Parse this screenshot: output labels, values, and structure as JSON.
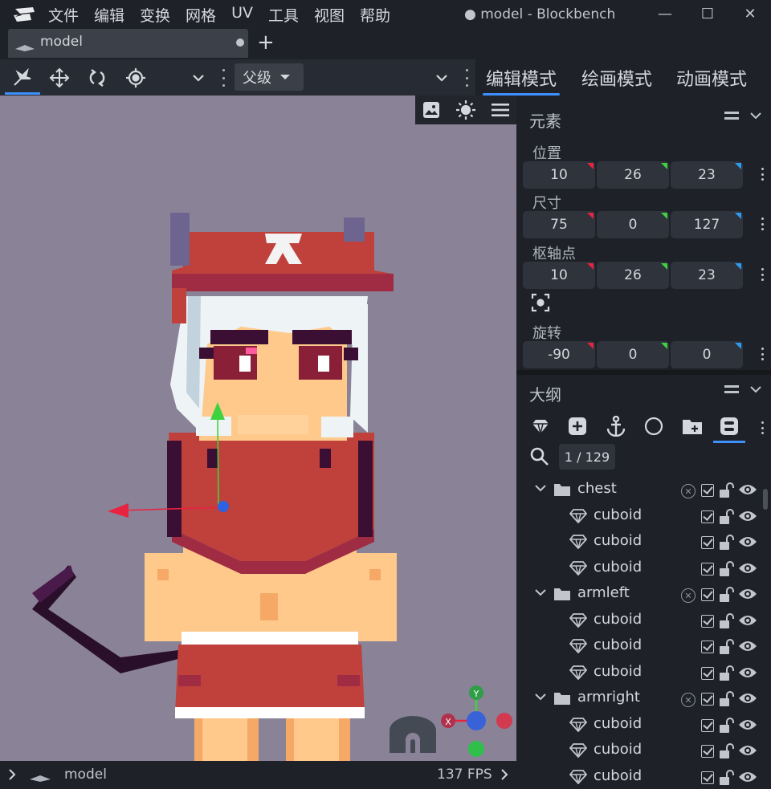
{
  "titlebar": {
    "menu": [
      "文件",
      "编辑",
      "变换",
      "网格",
      "UV",
      "工具",
      "视图",
      "帮助"
    ],
    "window_title": "● model - Blockbench",
    "minimize": "—",
    "maximize": "☐",
    "close": "✕"
  },
  "tabs": [
    {
      "label": "model",
      "unsaved": true
    }
  ],
  "tab_add": "+",
  "toolbar": {
    "tools": [
      "move-pivot-icon",
      "translate-icon",
      "rotate-icon",
      "pivot-target-icon"
    ],
    "space_select": "父级",
    "modes": [
      "编辑模式",
      "绘画模式",
      "动画模式"
    ],
    "active_mode": "编辑模式"
  },
  "viewport": {
    "tools": [
      "image-icon",
      "brightness-icon",
      "menu-icon"
    ],
    "gizmo": {
      "x": "X",
      "y": "Y"
    }
  },
  "statusbar": {
    "model_name": "model",
    "fps": "137 FPS"
  },
  "element_panel": {
    "title": "元素",
    "position": {
      "label": "位置",
      "values": [
        "10",
        "26",
        "23"
      ]
    },
    "size": {
      "label": "尺寸",
      "values": [
        "75",
        "0",
        "127"
      ]
    },
    "pivot": {
      "label": "枢轴点",
      "values": [
        "10",
        "26",
        "23"
      ]
    },
    "rotation": {
      "label": "旋转",
      "values": [
        "-90",
        "0",
        "0"
      ]
    },
    "axis_colors": [
      "#e8233f",
      "#3fd23f",
      "#2d9bf0"
    ]
  },
  "outliner": {
    "title": "大纲",
    "tools": [
      "cube-icon",
      "add-group-icon",
      "anchor-icon",
      "circle-icon",
      "add-folder-icon",
      "toggle-icon"
    ],
    "count": "1 / 129",
    "rows": [
      {
        "type": "group",
        "label": "chest"
      },
      {
        "type": "cube",
        "label": "cuboid"
      },
      {
        "type": "cube",
        "label": "cuboid"
      },
      {
        "type": "cube",
        "label": "cuboid"
      },
      {
        "type": "group",
        "label": "armleft"
      },
      {
        "type": "cube",
        "label": "cuboid"
      },
      {
        "type": "cube",
        "label": "cuboid"
      },
      {
        "type": "cube",
        "label": "cuboid"
      },
      {
        "type": "group",
        "label": "armright"
      },
      {
        "type": "cube",
        "label": "cuboid"
      },
      {
        "type": "cube",
        "label": "cuboid"
      },
      {
        "type": "cube",
        "label": "cuboid"
      }
    ]
  },
  "colors": {
    "accent": "#3e90ff",
    "viewport_bg": "#8a8398",
    "panel_bg": "#1e2127"
  }
}
